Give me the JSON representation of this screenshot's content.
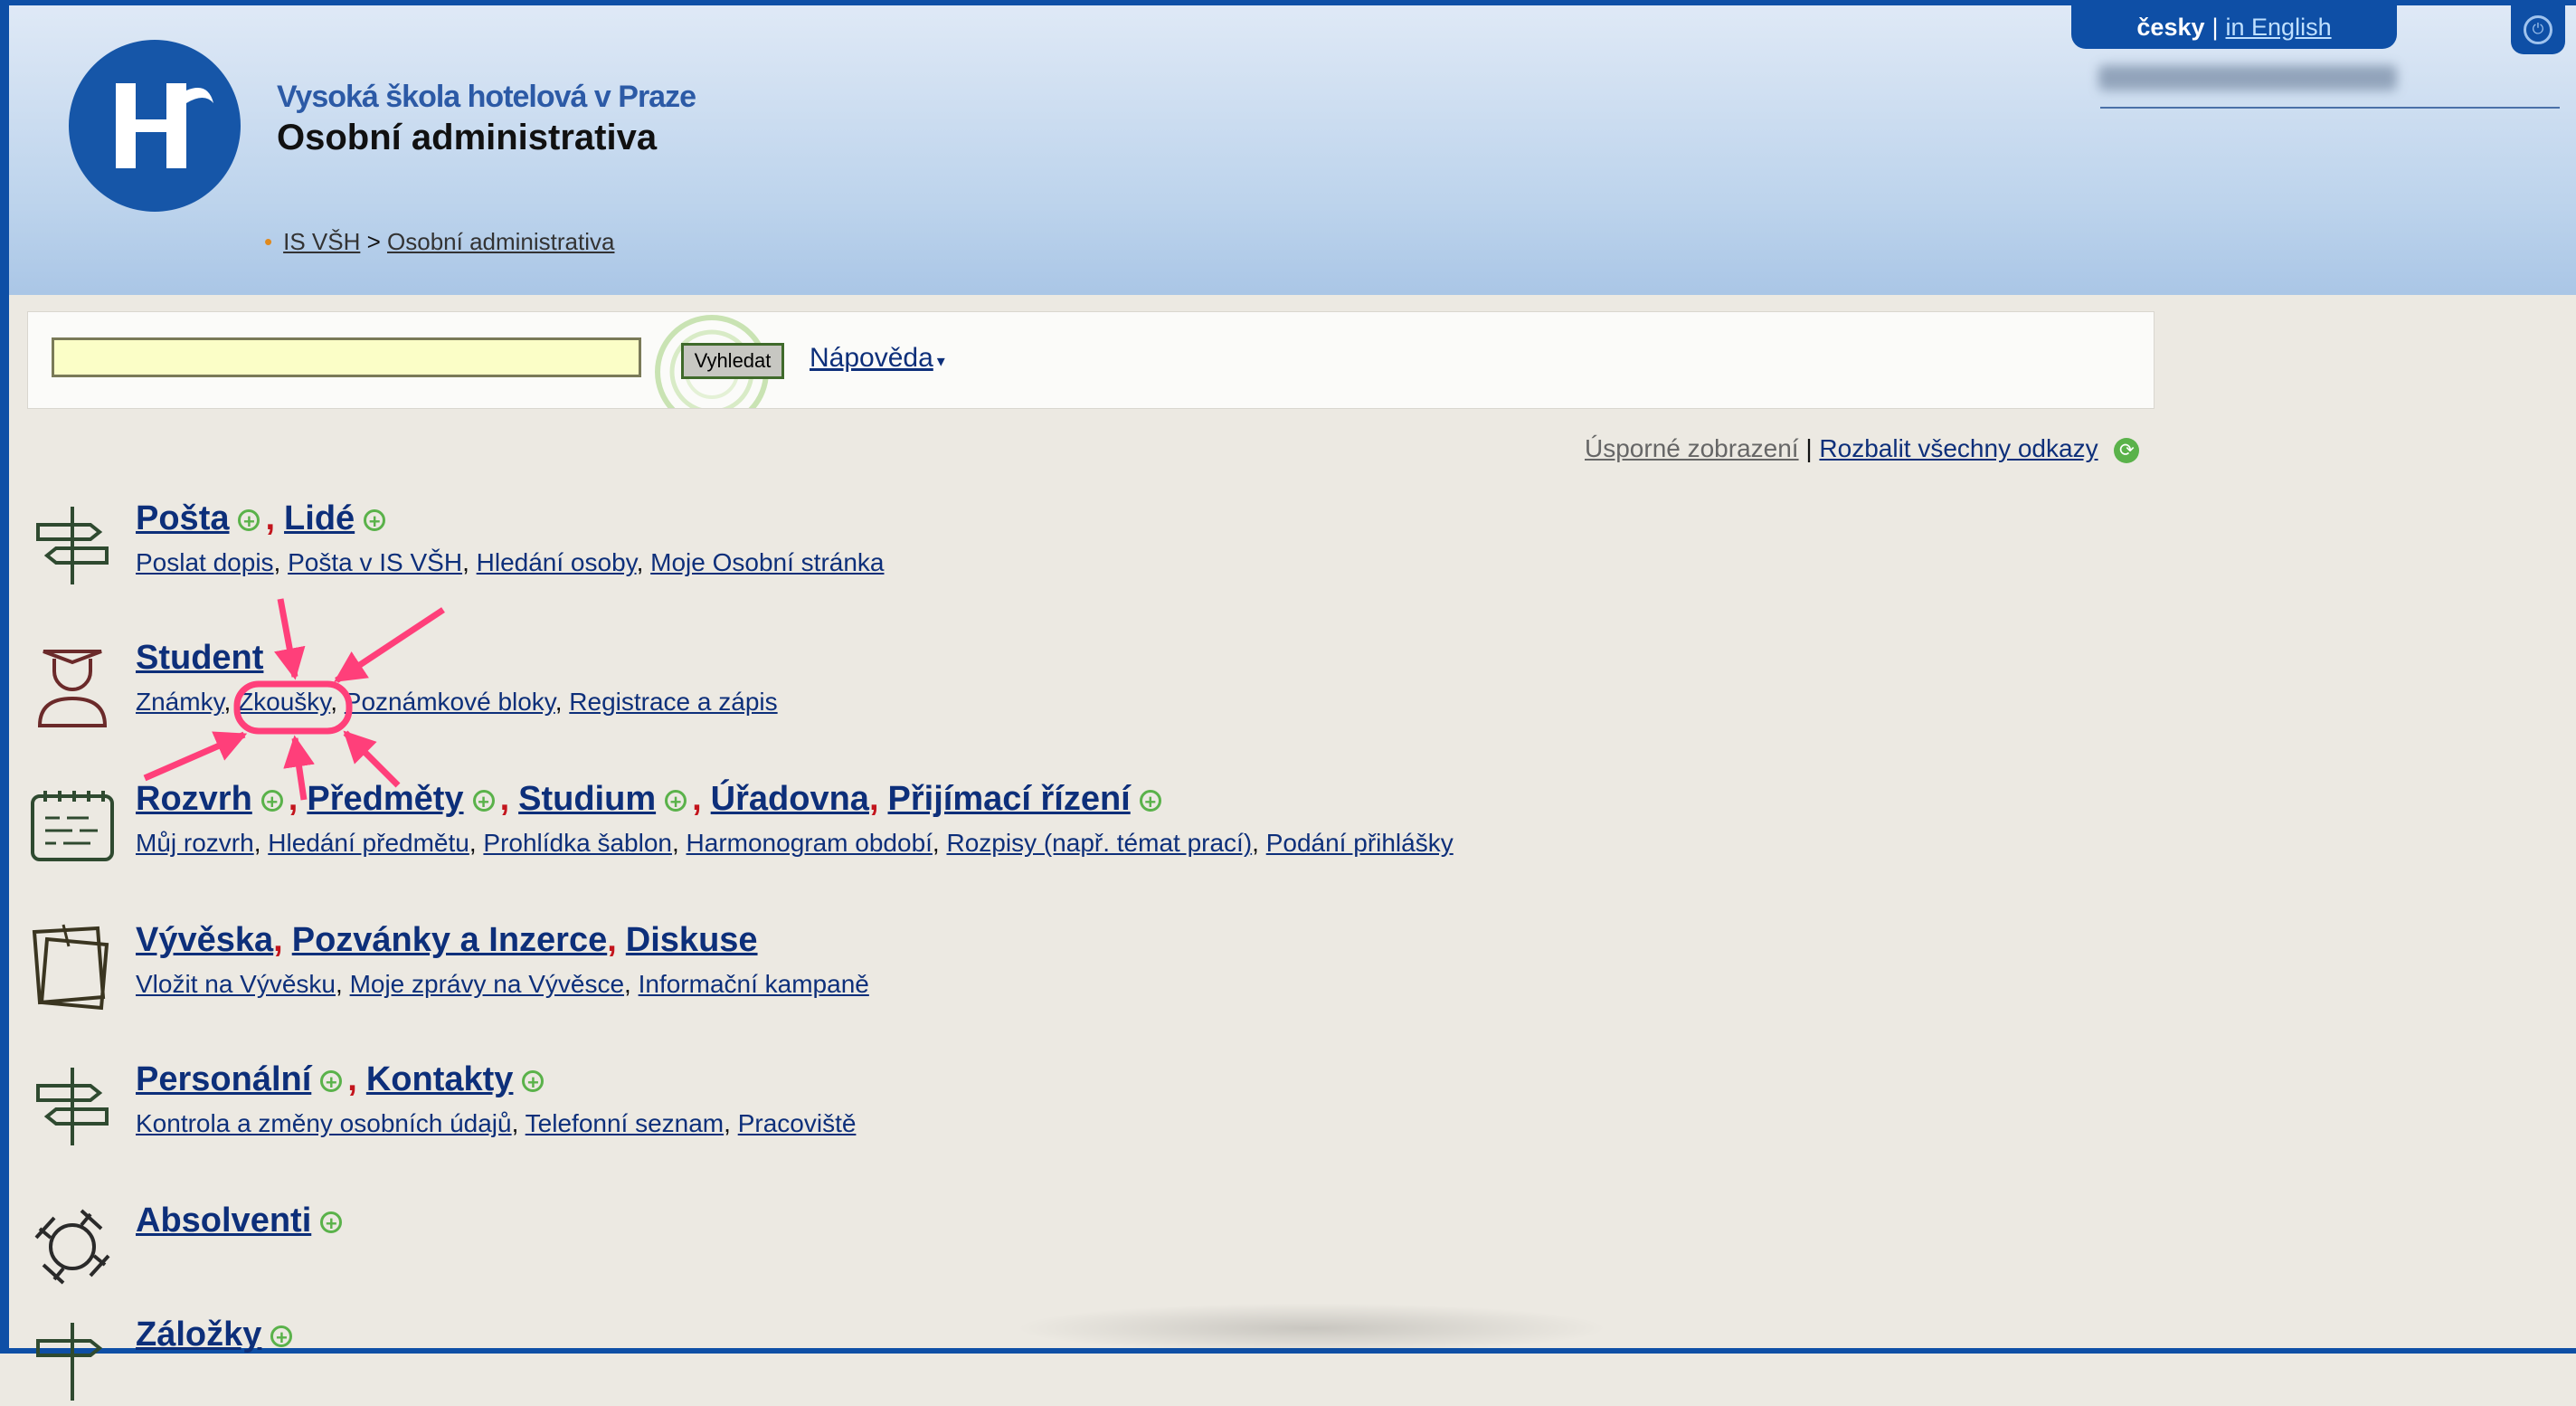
{
  "header": {
    "school_name": "Vysoká škola hotelová v Praze",
    "app_title": "Osobní administrativa",
    "breadcrumb": {
      "root": "IS VŠH",
      "separator": ">",
      "current": "Osobní administrativa"
    },
    "language": {
      "current": "česky",
      "separator": "|",
      "other": "in English"
    },
    "logo_letter": "H"
  },
  "search": {
    "value": "",
    "button_label": "Vyhledat",
    "help_label": "Nápověda",
    "help_caret": "▾"
  },
  "view_links": {
    "compact": "Úsporné zobrazení",
    "separator": "|",
    "expand_all": "Rozbalit všechny odkazy"
  },
  "sections": [
    {
      "icon": "signpost-icon",
      "titles": [
        "Pošta",
        "Lidé"
      ],
      "links": [
        "Poslat dopis",
        "Pošta v IS VŠH",
        "Hledání osoby",
        "Moje Osobní stránka"
      ]
    },
    {
      "icon": "student-icon",
      "titles": [
        "Student"
      ],
      "links": [
        "Známky",
        "Zkoušky",
        "Poznámkové bloky",
        "Registrace a zápis"
      ]
    },
    {
      "icon": "calendar-icon",
      "titles": [
        "Rozvrh",
        "Předměty",
        "Studium",
        "Úřadovna",
        "Přijímací řízení"
      ],
      "links": [
        "Můj rozvrh",
        "Hledání předmětu",
        "Prohlídka šablon",
        "Harmonogram období",
        "Rozpisy (např. témat prací)",
        "Podání přihlášky"
      ]
    },
    {
      "icon": "notes-icon",
      "titles": [
        "Vývěska",
        "Pozvánky a Inzerce",
        "Diskuse"
      ],
      "links": [
        "Vložit na Vývěsku",
        "Moje zprávy na Vývěsce",
        "Informační kampaně"
      ]
    },
    {
      "icon": "signpost-icon",
      "titles": [
        "Personální",
        "Kontakty"
      ],
      "links": [
        "Kontrola a změny osobních údajů",
        "Telefonní seznam",
        "Pracoviště"
      ]
    },
    {
      "icon": "hands-circle-icon",
      "titles": [
        "Absolventi"
      ],
      "links": []
    },
    {
      "icon": "signpost-icon",
      "titles": [
        "Záložky"
      ],
      "links": []
    }
  ],
  "colors": {
    "frame": "#0e4fa6",
    "link": "#0d2f7a",
    "plus": "#5ab24a",
    "annotation": "#ff3f7a",
    "search_field": "#fbfec7"
  }
}
